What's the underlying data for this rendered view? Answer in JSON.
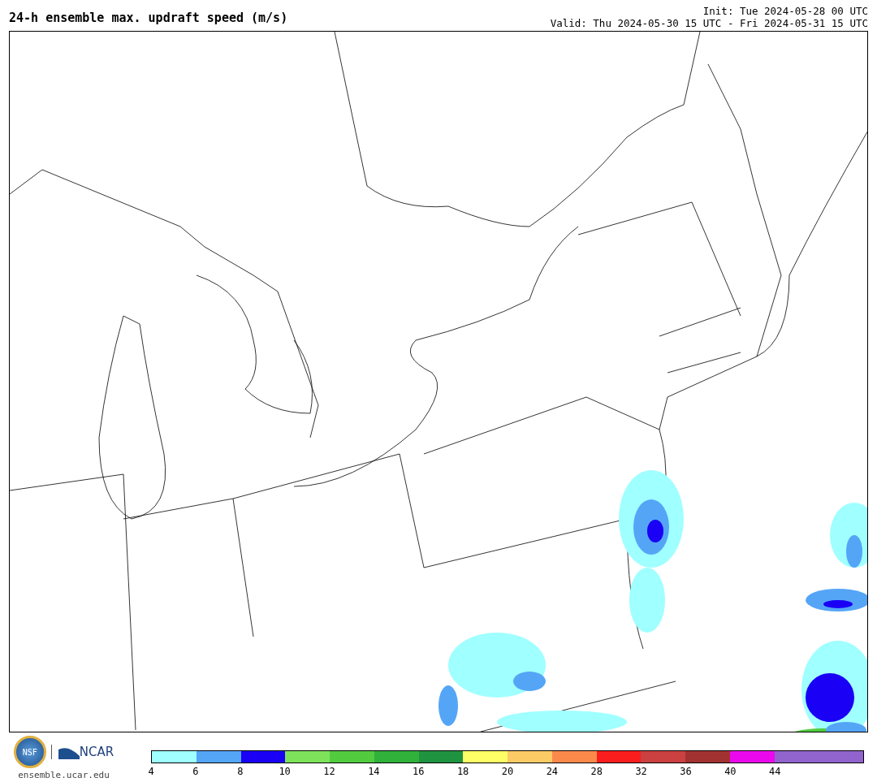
{
  "title": "24-h ensemble max. updraft speed (m/s)",
  "init": "Init: Tue 2024-05-28 00 UTC",
  "valid": "Valid: Thu 2024-05-30 15 UTC - Fri 2024-05-31 15 UTC",
  "logos": {
    "nsf": "NSF",
    "ncar": "NCAR",
    "site": "ensemble.ucar.edu"
  },
  "colorbar": [
    {
      "label": "4",
      "color": "#a0ffff"
    },
    {
      "label": "6",
      "color": "#55a5f7"
    },
    {
      "label": "8",
      "color": "#1a00f5"
    },
    {
      "label": "10",
      "color": "#7ee25a"
    },
    {
      "label": "12",
      "color": "#52cb3f"
    },
    {
      "label": "14",
      "color": "#2fb13a"
    },
    {
      "label": "16",
      "color": "#1f9340"
    },
    {
      "label": "18",
      "color": "#fefe66"
    },
    {
      "label": "20",
      "color": "#fdcb65"
    },
    {
      "label": "24",
      "color": "#fb8a4a"
    },
    {
      "label": "28",
      "color": "#f91d1d"
    },
    {
      "label": "32",
      "color": "#cb4040"
    },
    {
      "label": "36",
      "color": "#a23232"
    },
    {
      "label": "40",
      "color": "#ec08ec"
    },
    {
      "label": "44",
      "color": "#9163cc"
    },
    {
      "color": "#9163cc"
    }
  ]
}
